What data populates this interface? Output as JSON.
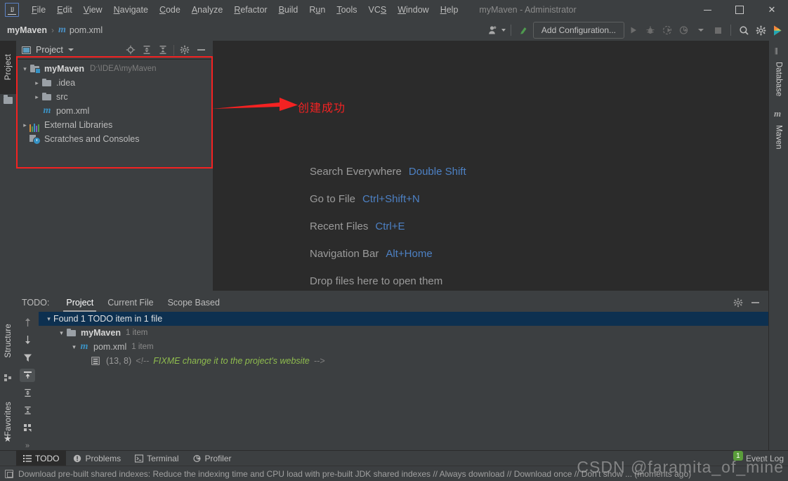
{
  "window": {
    "title": "myMaven - Administrator",
    "logo_icon": "intellij-idea-logo",
    "minimize_label": "—",
    "maximize_label": "□",
    "close_label": "✕"
  },
  "menubar": {
    "items": [
      {
        "label": "File",
        "mnemonic": "F"
      },
      {
        "label": "Edit",
        "mnemonic": "E"
      },
      {
        "label": "View",
        "mnemonic": "V"
      },
      {
        "label": "Navigate",
        "mnemonic": "N"
      },
      {
        "label": "Code",
        "mnemonic": "C"
      },
      {
        "label": "Analyze",
        "mnemonic": "A"
      },
      {
        "label": "Refactor",
        "mnemonic": "R"
      },
      {
        "label": "Build",
        "mnemonic": "B"
      },
      {
        "label": "Run",
        "mnemonic": "u"
      },
      {
        "label": "Tools",
        "mnemonic": "T"
      },
      {
        "label": "VCS",
        "mnemonic": "S"
      },
      {
        "label": "Window",
        "mnemonic": "W"
      },
      {
        "label": "Help",
        "mnemonic": "H"
      }
    ]
  },
  "navbar": {
    "breadcrumb": {
      "project": "myMaven",
      "separator": "›",
      "file_icon": "maven-pom-icon",
      "file": "pom.xml"
    },
    "toolbar": {
      "user_icon": "user-account-icon",
      "update_icon": "update-project-icon",
      "add_configuration": "Add Configuration...",
      "run_icon": "run-icon",
      "debug_icon": "debug-icon",
      "run_coverage_icon": "run-with-coverage-icon",
      "profile_icon": "profile-icon",
      "profile_dropdown_icon": "chevron-down-icon",
      "stop_icon": "stop-icon",
      "search_icon": "search-everywhere-icon",
      "settings_icon": "settings-gear-icon",
      "ide_icon": "ide-brand-icon"
    }
  },
  "left_strip_top": {
    "tab_label": "Project",
    "folder_icon": "folder-icon"
  },
  "project_panel": {
    "title": "Project",
    "title_icon": "project-view-icon",
    "dropdown_icon": "chevron-down-icon",
    "actions": [
      {
        "name": "scroll-from-source-icon",
        "glyph": "⊕"
      },
      {
        "name": "expand-all-icon",
        "glyph": "expand"
      },
      {
        "name": "collapse-all-icon",
        "glyph": "collapse"
      },
      {
        "name": "settings-gear-icon",
        "glyph": "gear"
      },
      {
        "name": "hide-icon",
        "glyph": "minus"
      }
    ],
    "tree": [
      {
        "label": "myMaven",
        "path": "D:\\IDEA\\myMaven",
        "icon": "module-folder-icon",
        "arrow": "⌄",
        "depth": 0,
        "bold": true
      },
      {
        "label": ".idea",
        "path": "",
        "icon": "folder-icon",
        "arrow": "›",
        "depth": 1,
        "bold": false
      },
      {
        "label": "src",
        "path": "",
        "icon": "folder-icon",
        "arrow": "›",
        "depth": 1,
        "bold": false
      },
      {
        "label": "pom.xml",
        "path": "",
        "icon": "maven-pom-icon",
        "arrow": "",
        "depth": 1,
        "bold": false
      },
      {
        "label": "External Libraries",
        "path": "",
        "icon": "libraries-icon",
        "arrow": "›",
        "depth": 0,
        "bold": false
      },
      {
        "label": "Scratches and Consoles",
        "path": "",
        "icon": "scratches-icon",
        "arrow": "",
        "depth": 0,
        "bold": false
      }
    ]
  },
  "annotation": {
    "text": "创建成功",
    "color": "#f42222",
    "rect_name": "red-highlight-rectangle",
    "arrow_name": "red-arrow"
  },
  "editor": {
    "hints": [
      {
        "label": "Search Everywhere",
        "shortcut": "Double Shift"
      },
      {
        "label": "Go to File",
        "shortcut": "Ctrl+Shift+N"
      },
      {
        "label": "Recent Files",
        "shortcut": "Ctrl+E"
      },
      {
        "label": "Navigation Bar",
        "shortcut": "Alt+Home"
      },
      {
        "label": "Drop files here to open them",
        "shortcut": ""
      }
    ]
  },
  "todo_panel": {
    "caption": "TODO:",
    "tabs": [
      {
        "label": "Project",
        "active": true
      },
      {
        "label": "Current File",
        "active": false
      },
      {
        "label": "Scope Based",
        "active": false
      }
    ],
    "header_actions": [
      {
        "name": "settings-gear-icon"
      },
      {
        "name": "hide-icon"
      }
    ],
    "side_actions": [
      {
        "name": "previous-occurrence-icon",
        "glyph": "↑",
        "selected": false
      },
      {
        "name": "next-occurrence-icon",
        "glyph": "↓",
        "selected": false
      },
      {
        "name": "filter-icon",
        "glyph": "filter",
        "selected": false
      },
      {
        "name": "autoscroll-to-source-icon",
        "glyph": "autoscroll",
        "selected": true
      },
      {
        "name": "expand-all-icon",
        "glyph": "expand",
        "selected": false
      },
      {
        "name": "collapse-all-icon",
        "glyph": "collapse",
        "selected": false
      },
      {
        "name": "group-by-icon",
        "glyph": "group",
        "selected": false
      },
      {
        "name": "more-icon",
        "glyph": "»",
        "selected": false
      }
    ],
    "rows": [
      {
        "arrow": "⌄",
        "label": "Found 1 TODO item in 1 file",
        "count": "",
        "icon": "",
        "depth": 0,
        "selected": true,
        "bold": false
      },
      {
        "arrow": "⌄",
        "label": "myMaven",
        "count": "1 item",
        "icon": "folder-icon",
        "depth": 1,
        "selected": false,
        "bold": true
      },
      {
        "arrow": "⌄",
        "label": "pom.xml",
        "count": "1 item",
        "icon": "maven-pom-icon",
        "depth": 2,
        "selected": false,
        "bold": false
      }
    ],
    "item": {
      "icon": "todo-line-icon",
      "position": "(13, 8)",
      "comment_open": "<!--",
      "text": "FIXME change it to the project's website",
      "comment_close": "-->"
    }
  },
  "left_strip_bottom": {
    "structure_label": "Structure",
    "structure_icon": "structure-icon",
    "favorites_label": "Favorites",
    "favorites_icon": "star-icon"
  },
  "right_strip": {
    "database_label": "Database",
    "database_icon": "database-icon",
    "maven_label": "Maven",
    "maven_icon": "maven-icon"
  },
  "bottom_tabs": [
    {
      "label": "TODO",
      "icon": "todo-icon",
      "active": true
    },
    {
      "label": "Problems",
      "icon": "problems-icon",
      "active": false
    },
    {
      "label": "Terminal",
      "icon": "terminal-icon",
      "active": false
    },
    {
      "label": "Profiler",
      "icon": "profiler-icon",
      "active": false
    }
  ],
  "event_log": {
    "badge": "1",
    "label": "Event Log",
    "badge_color": "#5a9e3a"
  },
  "statusbar": {
    "icon": "notification-icon",
    "message": "Download pre-built shared indexes: Reduce the indexing time and CPU load with pre-built JDK shared indexes // Always download // Download once // Don't show ... (moments ago)"
  },
  "watermark": {
    "text": "CSDN @faramita_of_mine"
  }
}
